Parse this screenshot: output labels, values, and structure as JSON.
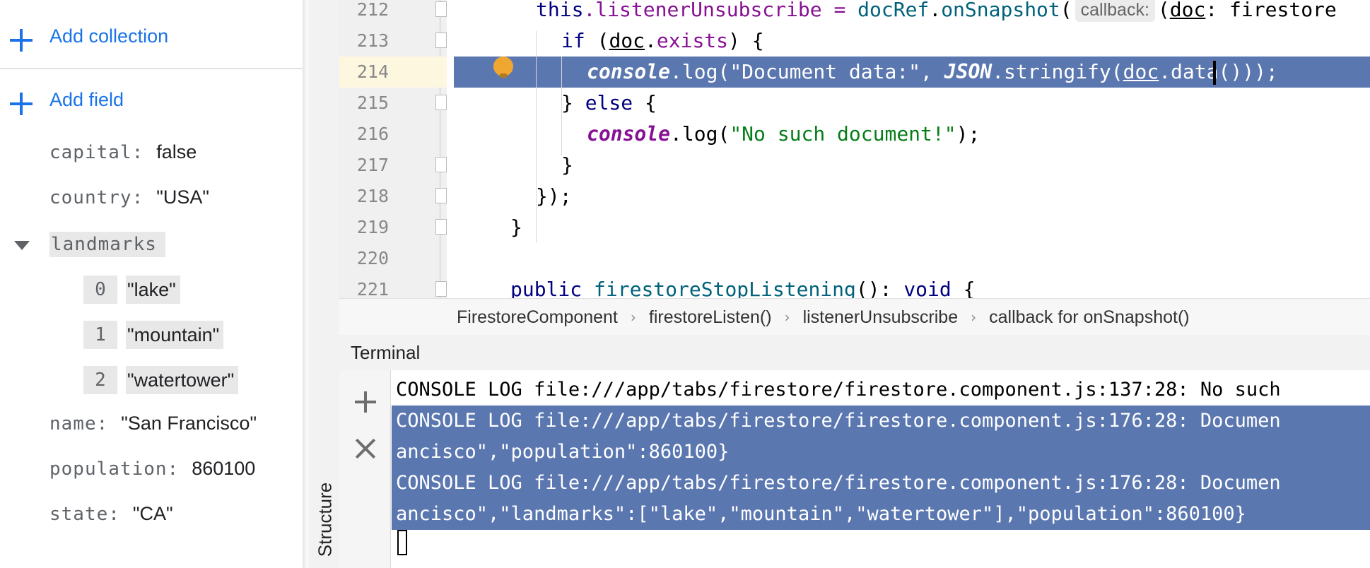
{
  "firestore_panel": {
    "add_collection_label": "Add collection",
    "add_field_label": "Add field",
    "fields": [
      {
        "key": "capital:",
        "value": "false"
      },
      {
        "key": "country:",
        "value": "\"USA\""
      },
      {
        "key": "name:",
        "value": "\"San Francisco\""
      },
      {
        "key": "population:",
        "value": "860100"
      },
      {
        "key": "state:",
        "value": "\"CA\""
      }
    ],
    "landmarks": {
      "key": "landmarks",
      "items": [
        {
          "index": "0",
          "value": "\"lake\""
        },
        {
          "index": "1",
          "value": "\"mountain\""
        },
        {
          "index": "2",
          "value": "\"watertower\""
        }
      ]
    }
  },
  "ide": {
    "structure_label": "Structure",
    "line_numbers": [
      "212",
      "213",
      "214",
      "215",
      "216",
      "217",
      "218",
      "219",
      "220",
      "221"
    ],
    "code": {
      "l212_a": "this",
      "l212_b": ".listenerUnsubscribe = ",
      "l212_c": "docRef",
      "l212_d": ".",
      "l212_e": "onSnapshot",
      "l212_f": "(",
      "l212_hint": "callback:",
      "l212_g": "(",
      "l212_h": "doc",
      "l212_i": ": firestore",
      "l213_a": "if",
      "l213_b": " (",
      "l213_c": "doc",
      "l213_d": ".",
      "l213_e": "exists",
      "l213_f": ") {",
      "l214_a": "console",
      "l214_b": ".log(",
      "l214_c": "\"Document data:\"",
      "l214_d": ", ",
      "l214_e": "JSON",
      "l214_f": ".stringify(",
      "l214_g": "doc",
      "l214_h": ".data()));",
      "l215_a": "} ",
      "l215_b": "else",
      "l215_c": " {",
      "l216_a": "console",
      "l216_b": ".log(",
      "l216_c": "\"No such document!\"",
      "l216_d": ");",
      "l217": "}",
      "l218": "});",
      "l219": "}",
      "l221_a": "public",
      "l221_b": " ",
      "l221_c": "firestoreStopListening",
      "l221_d": "(): ",
      "l221_e": "void",
      "l221_f": " {"
    },
    "breadcrumb": [
      "FirestoreComponent",
      "firestoreListen()",
      "listenerUnsubscribe",
      "callback for onSnapshot()"
    ],
    "breadcrumb_sep": "›",
    "terminal_title": "Terminal",
    "terminal_lines": [
      "CONSOLE LOG file:///app/tabs/firestore/firestore.component.js:137:28: No such",
      "CONSOLE LOG file:///app/tabs/firestore/firestore.component.js:176:28: Documen",
      "ancisco\",\"population\":860100}",
      "CONSOLE LOG file:///app/tabs/firestore/firestore.component.js:176:28: Documen",
      "ancisco\",\"landmarks\":[\"lake\",\"mountain\",\"watertower\"],\"population\":860100}"
    ]
  }
}
